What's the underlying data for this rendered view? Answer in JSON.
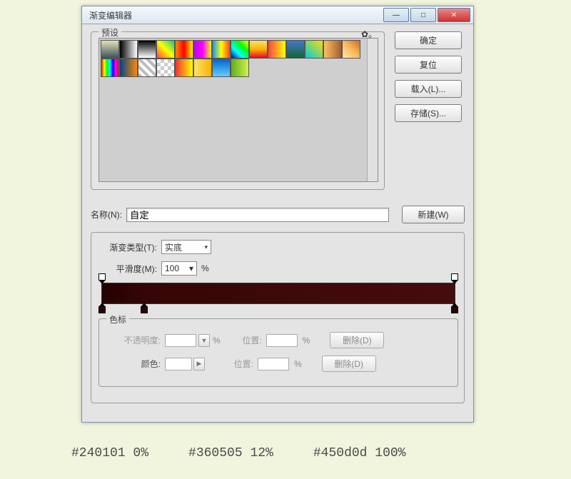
{
  "dialog": {
    "title": "渐变编辑器",
    "min": "—",
    "max": "□",
    "close": "✕",
    "presets_legend": "预设",
    "cog": "✿。",
    "ok": "确定",
    "reset": "复位",
    "load": "载入(L)...",
    "save": "存储(S)...",
    "name_label": "名称(N):",
    "name_value": "自定",
    "new_btn": "新建(W)",
    "gtype_label": "渐变类型(T):",
    "gtype_value": "实底",
    "smooth_label": "平滑度(M):",
    "smooth_value": "100",
    "pct": "%",
    "stops_legend": "色标",
    "opacity_label": "不透明度:",
    "position_label": "位置:",
    "color_label": "颜色:",
    "delete": "删除(D)",
    "arrow": "▼",
    "play": "▶"
  },
  "footer": {
    "s1": "#240101   0%",
    "s2": "#360505  12%",
    "s3": "#450d0d  100%"
  },
  "gradient_stops": [
    {
      "color": "#240101",
      "pos": 0
    },
    {
      "color": "#360505",
      "pos": 12
    },
    {
      "color": "#450d0d",
      "pos": 100
    }
  ]
}
